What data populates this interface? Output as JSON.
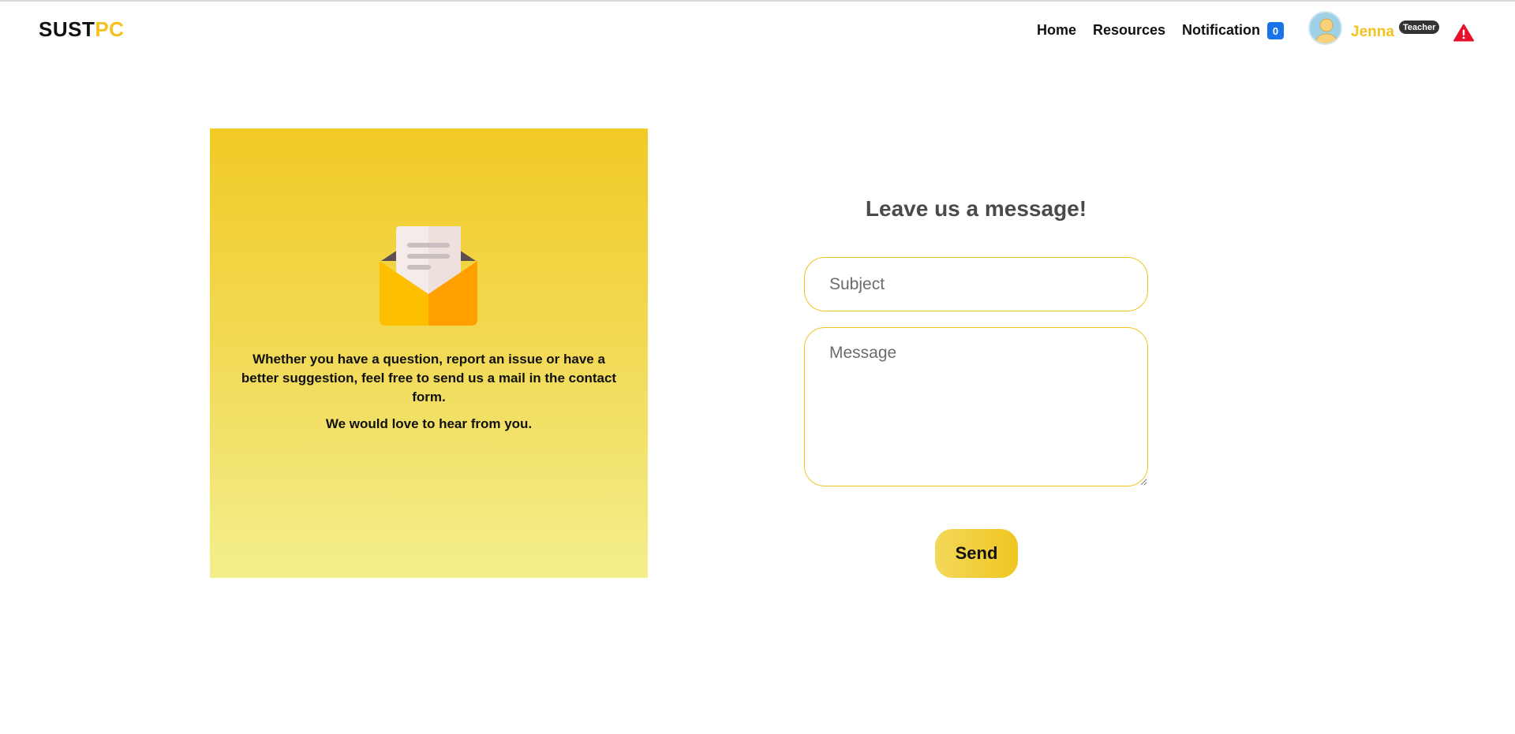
{
  "navbar": {
    "brand_part1": "SUST",
    "brand_part2": "PC",
    "links": {
      "home": "Home",
      "resources": "Resources",
      "notification": "Notification"
    },
    "notification_count": "0",
    "user": {
      "name": "Jenna",
      "role": "Teacher",
      "avatar_icon": "user-avatar-icon"
    },
    "alert_icon": "warning-triangle-icon"
  },
  "info_card": {
    "icon": "envelope-letter-icon",
    "paragraph1": "Whether you have a question, report an issue or have a better suggestion, feel free to send us a mail in the contact form.",
    "paragraph2": "We would love to hear from you."
  },
  "form": {
    "title": "Leave us a message!",
    "subject_placeholder": "Subject",
    "message_placeholder": "Message",
    "send_label": "Send"
  },
  "colors": {
    "accent": "#f4c21f",
    "badge_blue": "#1a73e8",
    "alert_red": "#e8112d"
  }
}
